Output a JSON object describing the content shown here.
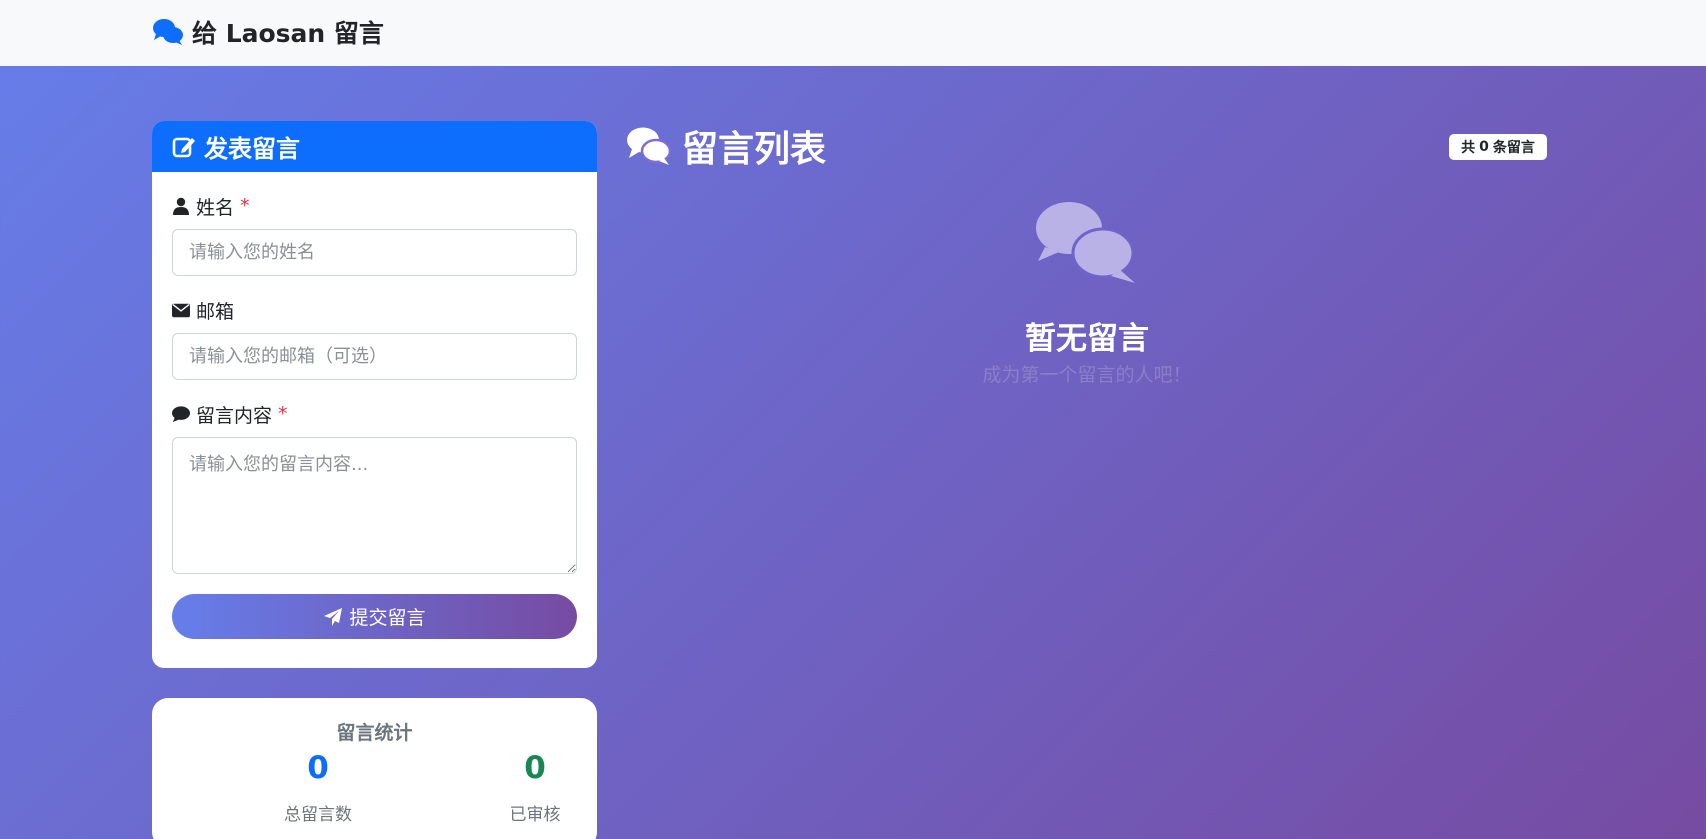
{
  "app": {
    "brand": "给 Laosan 留言",
    "brand_icon": "comments-icon"
  },
  "form": {
    "header": "发表留言",
    "header_icon": "edit-icon",
    "name_label": "姓名",
    "name_required": "*",
    "name_placeholder": "请输入您的姓名",
    "name_value": "",
    "email_label": "邮箱",
    "email_placeholder": "请输入您的邮箱（可选）",
    "email_value": "",
    "content_label": "留言内容",
    "content_required": "*",
    "content_placeholder": "请输入您的留言内容...",
    "content_value": "",
    "submit_label": "提交留言"
  },
  "stats": {
    "title": "留言统计",
    "total_value": "0",
    "total_label": "总留言数",
    "approved_value": "0",
    "approved_label": "已审核"
  },
  "list": {
    "title": "留言列表",
    "count_prefix": "共",
    "count": "0",
    "count_suffix": "条留言",
    "empty_title": "暂无留言",
    "empty_subtitle": "成为第一个留言的人吧！"
  },
  "colors": {
    "primary": "#0d6efd",
    "success": "#198754",
    "danger": "#dc3545",
    "gradient_start": "#667eea",
    "gradient_end": "#764ba2"
  }
}
